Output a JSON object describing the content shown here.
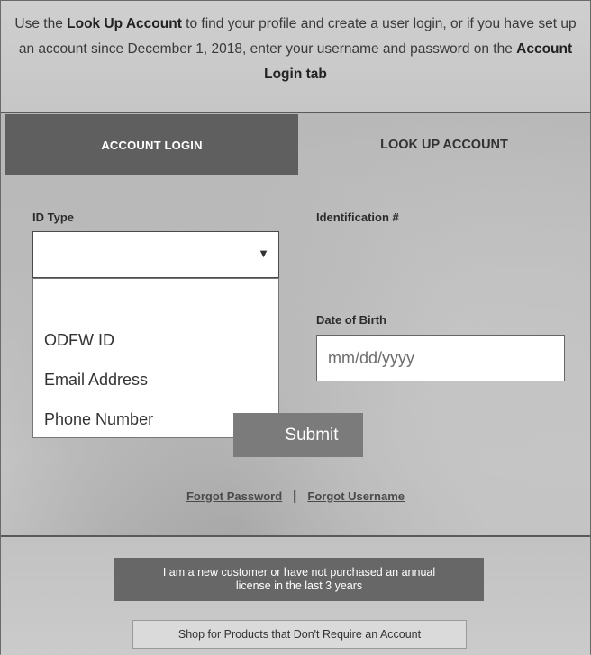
{
  "intro": {
    "text_1": "Use the ",
    "bold_1": "Look Up Account",
    "text_2": " to find your profile and create a user login, or if you have set up an account since December 1, 2018, enter your username and password on the ",
    "bold_2": "Account Login tab"
  },
  "tabs": {
    "account_login": "ACCOUNT LOGIN",
    "look_up_account": "LOOK UP ACCOUNT",
    "active": "account_login"
  },
  "form": {
    "id_type_label": "ID Type",
    "id_type_value": "",
    "id_type_options": [
      "ODFW ID",
      "Email Address",
      "Phone Number"
    ],
    "identification_label": "Identification #",
    "dob_label": "Date of Birth",
    "dob_placeholder": "mm/dd/yyyy",
    "submit_label": "Submit"
  },
  "links": {
    "forgot_password": "Forgot Password",
    "separator": "|",
    "forgot_username": "Forgot Username"
  },
  "footer": {
    "new_customer": "I am a new customer or have not purchased an annual license in the last 3 years",
    "shop": "Shop for Products that Don't Require an Account"
  },
  "icons": {
    "select_arrow": "caret-down-icon"
  }
}
